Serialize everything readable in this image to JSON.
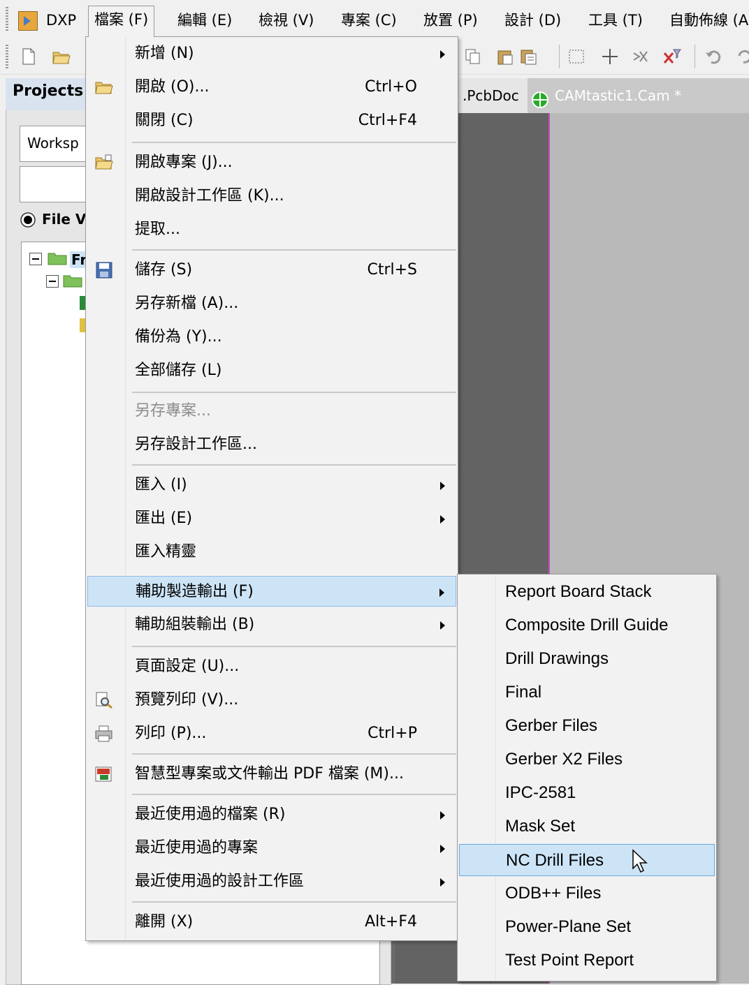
{
  "menubar": {
    "dxp": "DXP",
    "items": [
      "檔案 (F)",
      "編輯 (E)",
      "檢視 (V)",
      "專案 (C)",
      "放置 (P)",
      "設計 (D)",
      "工具 (T)",
      "自動佈線 (A"
    ]
  },
  "projects_panel": {
    "title": "Projects",
    "workspace_value": "Worksp",
    "file_view_label": "File Vi",
    "tree_root_label": "Fr"
  },
  "doc_tabs": [
    ".PcbDoc",
    "CAMtastic1.Cam *"
  ],
  "file_menu": {
    "items": [
      {
        "label": "新增 (N)",
        "shortcut": "",
        "submenu": true
      },
      {
        "label": "開啟 (O)...",
        "shortcut": "Ctrl+O",
        "icon": "open-folder-icon"
      },
      {
        "label": "關閉 (C)",
        "shortcut": "Ctrl+F4"
      },
      {
        "label": "開啟專案 (J)...",
        "shortcut": "",
        "icon": "open-project-icon"
      },
      {
        "label": "開啟設計工作區 (K)...",
        "shortcut": ""
      },
      {
        "label": "提取...",
        "shortcut": ""
      },
      {
        "label": "儲存 (S)",
        "shortcut": "Ctrl+S",
        "icon": "save-icon"
      },
      {
        "label": "另存新檔 (A)...",
        "shortcut": ""
      },
      {
        "label": "備份為 (Y)...",
        "shortcut": ""
      },
      {
        "label": "全部儲存 (L)",
        "shortcut": ""
      },
      {
        "label": "另存專案...",
        "shortcut": "",
        "disabled": true
      },
      {
        "label": "另存設計工作區...",
        "shortcut": ""
      },
      {
        "label": "匯入 (I)",
        "shortcut": "",
        "submenu": true
      },
      {
        "label": "匯出 (E)",
        "shortcut": "",
        "submenu": true
      },
      {
        "label": "匯入精靈",
        "shortcut": ""
      },
      {
        "label": "輔助製造輸出 (F)",
        "shortcut": "",
        "submenu": true,
        "highlighted": true
      },
      {
        "label": "輔助組裝輸出 (B)",
        "shortcut": "",
        "submenu": true
      },
      {
        "label": "頁面設定 (U)...",
        "shortcut": ""
      },
      {
        "label": "預覽列印 (V)...",
        "shortcut": "",
        "icon": "print-preview-icon"
      },
      {
        "label": "列印 (P)...",
        "shortcut": "Ctrl+P",
        "icon": "printer-icon"
      },
      {
        "label": "智慧型專案或文件輸出 PDF 檔案 (M)...",
        "shortcut": "",
        "icon": "pdf-export-icon"
      },
      {
        "label": "最近使用過的檔案 (R)",
        "shortcut": "",
        "submenu": true
      },
      {
        "label": "最近使用過的專案",
        "shortcut": "",
        "submenu": true
      },
      {
        "label": "最近使用過的設計工作區",
        "shortcut": "",
        "submenu": true
      },
      {
        "label": "離開 (X)",
        "shortcut": "Alt+F4"
      }
    ]
  },
  "fab_submenu": {
    "items": [
      "Report Board Stack",
      "Composite Drill Guide",
      "Drill Drawings",
      "Final",
      "Gerber Files",
      "Gerber X2 Files",
      "IPC-2581",
      "Mask Set",
      "NC Drill Files",
      "ODB++ Files",
      "Power-Plane Set",
      "Test Point Report"
    ],
    "highlighted": "NC Drill Files"
  },
  "colors": {
    "highlight": "#cde4f7",
    "highlight_border": "#8fbde8",
    "canvas_dark": "#636363",
    "canvas_light": "#b9b9b9",
    "canvas_line": "#c64cc6"
  }
}
